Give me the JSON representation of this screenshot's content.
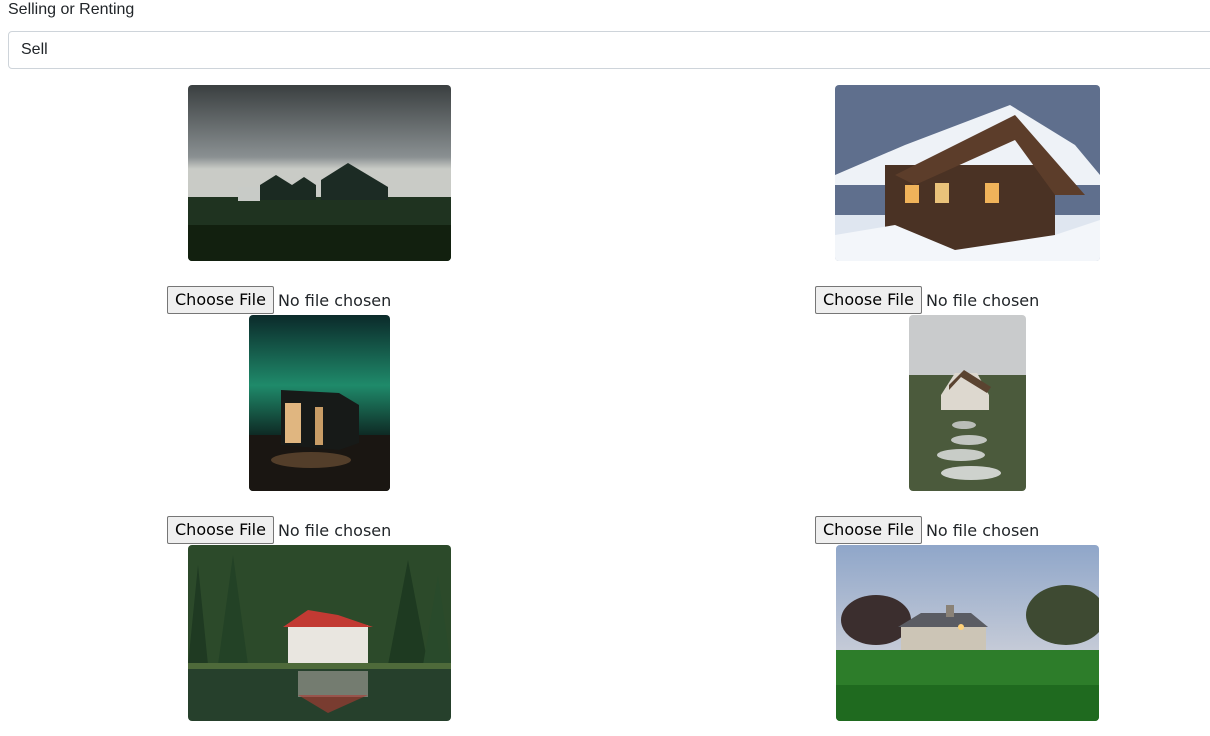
{
  "form": {
    "selling_label": "Selling or Renting",
    "selling_value": "Sell"
  },
  "uploads": [
    {
      "button_label": "Choose File",
      "status": "No file chosen"
    },
    {
      "button_label": "Choose File",
      "status": "No file chosen"
    },
    {
      "button_label": "Choose File",
      "status": "No file chosen"
    },
    {
      "button_label": "Choose File",
      "status": "No file chosen"
    }
  ]
}
